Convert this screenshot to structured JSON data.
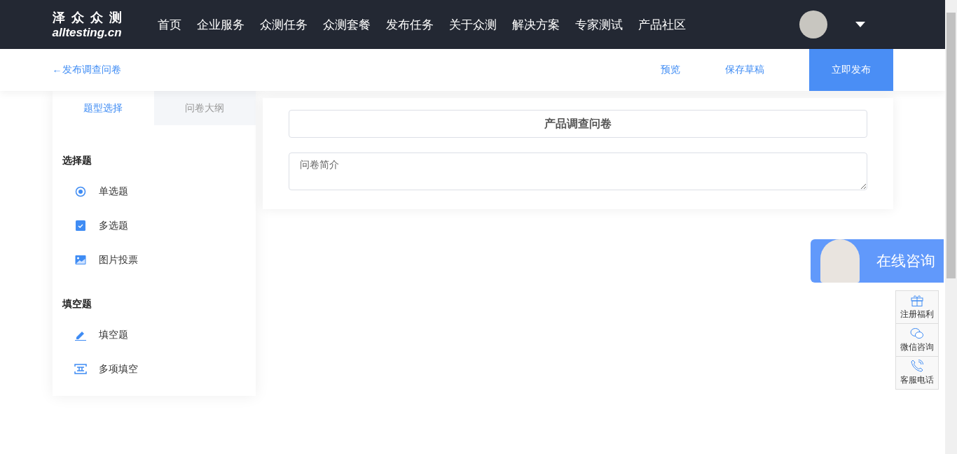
{
  "header": {
    "logo_cn": "泽 众 众 测",
    "logo_en": "alltesting.cn",
    "nav": [
      "首页",
      "企业服务",
      "众测任务",
      "众测套餐",
      "发布任务",
      "关于众测",
      "解决方案",
      "专家测试",
      "产品社区"
    ]
  },
  "toolbar": {
    "back": "←发布调查问卷",
    "actions": [
      {
        "label": "预览",
        "kind": "link"
      },
      {
        "label": "保存草稿",
        "kind": "link"
      },
      {
        "label": "立即发布",
        "kind": "primary"
      }
    ]
  },
  "sidebar": {
    "tabs": [
      {
        "label": "题型选择",
        "selected": true
      },
      {
        "label": "问卷大纲",
        "selected": false
      }
    ],
    "groups": [
      {
        "title": "选择题",
        "items": [
          {
            "label": "单选题",
            "kind": "radio"
          },
          {
            "label": "多选题",
            "kind": "checkbox"
          },
          {
            "label": "图片投票",
            "kind": "image"
          }
        ]
      },
      {
        "title": "填空题",
        "items": [
          {
            "label": "填空题",
            "kind": "pencil"
          },
          {
            "label": "多项填空",
            "kind": "multi"
          }
        ]
      }
    ]
  },
  "survey": {
    "title": "产品调查问卷",
    "intro_placeholder": "问卷简介"
  },
  "float": {
    "consult": "在线咨询",
    "buttons": [
      {
        "label": "注册福利",
        "kind": "gift"
      },
      {
        "label": "微信咨询",
        "kind": "chat"
      },
      {
        "label": "客服电话",
        "kind": "phone"
      }
    ]
  }
}
